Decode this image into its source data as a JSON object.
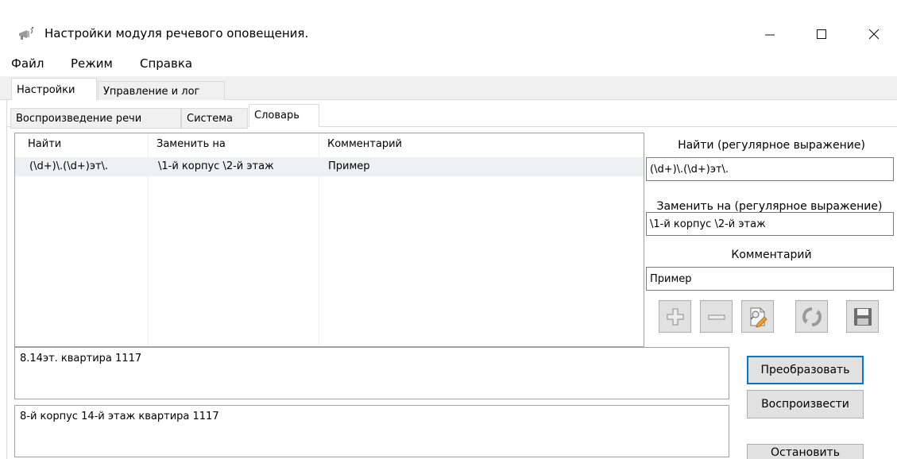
{
  "window": {
    "title": "Настройки модуля речевого оповещения.",
    "icon": "megaphone-icon",
    "controls": {
      "minimize": "—",
      "maximize": "☐",
      "close": "✕"
    }
  },
  "menu": [
    "Файл",
    "Режим",
    "Справка"
  ],
  "outer_tabs": [
    {
      "label": "Настройки",
      "active": true
    },
    {
      "label": "Управление и лог",
      "active": false
    }
  ],
  "inner_tabs": [
    {
      "label": "Воспроизведение речи",
      "active": false
    },
    {
      "label": "Система",
      "active": false
    },
    {
      "label": "Словарь",
      "active": true
    }
  ],
  "dictionary": {
    "columns": [
      "Найти",
      "Заменить на",
      "Комментарий"
    ],
    "rows": [
      {
        "find": "(\\d+)\\.(\\d+)эт\\.",
        "replace": "\\1-й корпус \\2-й этаж",
        "comment": "Пример"
      }
    ]
  },
  "editor": {
    "find_label": "Найти (регулярное выражение)",
    "find_value": "(\\d+)\\.(\\d+)эт\\.",
    "replace_label": "Заменить на (регулярное выражение)",
    "replace_value": "\\1-й корпус \\2-й этаж",
    "comment_label": "Комментарий",
    "comment_value": "Пример",
    "tool_buttons": [
      "plus-icon",
      "minus-icon",
      "edit-document-icon",
      "refresh-icon",
      "save-icon"
    ]
  },
  "conversion": {
    "input_text": "8.14эт. квартира 1117",
    "output_text": "8-й корпус 14-й этаж квартира 1117",
    "convert_label": "Преобразовать",
    "play_label": "Воспроизвести",
    "stop_label": "Остановить"
  },
  "colors": {
    "focus_border": "#0078d7",
    "tab_background": "#f0f0f0",
    "button_face": "#e1e1e1",
    "selected_row": "#eef0f3"
  }
}
